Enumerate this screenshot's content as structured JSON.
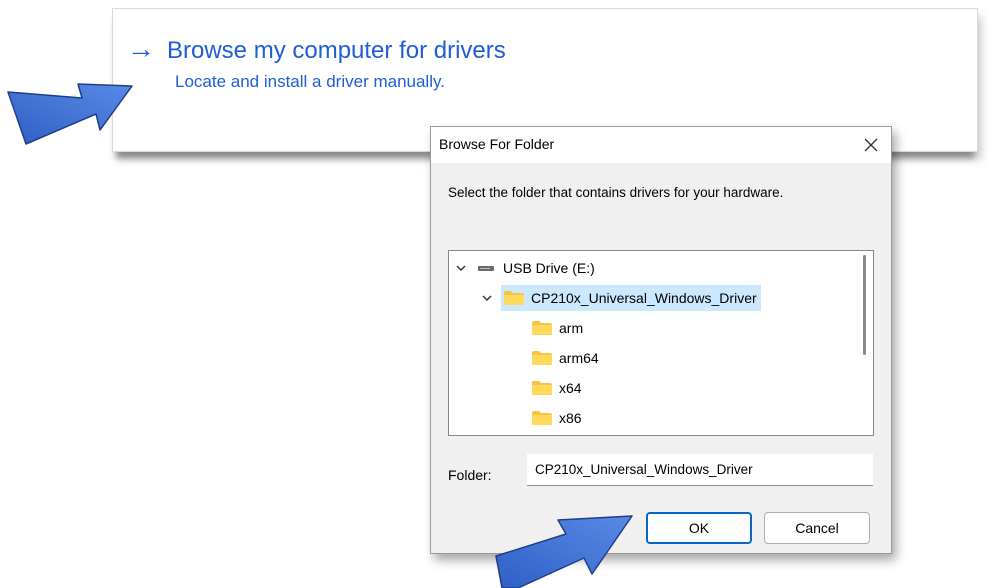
{
  "option": {
    "arrow": "→",
    "title": "Browse my computer for drivers",
    "subtitle": "Locate and install a driver manually."
  },
  "dialog": {
    "title": "Browse For Folder",
    "close_icon": "close-icon",
    "instruction": "Select the folder that contains drivers for your hardware.",
    "tree": [
      {
        "label": "USB Drive (E:)",
        "icon": "drive-icon",
        "expanded": true,
        "level": 0
      },
      {
        "label": "CP210x_Universal_Windows_Driver",
        "icon": "folder-icon",
        "expanded": true,
        "selected": true,
        "level": 1
      },
      {
        "label": "arm",
        "icon": "folder-icon",
        "level": 2
      },
      {
        "label": "arm64",
        "icon": "folder-icon",
        "level": 2
      },
      {
        "label": "x64",
        "icon": "folder-icon",
        "level": 2
      },
      {
        "label": "x86",
        "icon": "folder-icon",
        "level": 2
      }
    ],
    "folder_label": "Folder:",
    "folder_value": "CP210x_Universal_Windows_Driver",
    "ok_label": "OK",
    "cancel_label": "Cancel"
  },
  "colors": {
    "link_blue": "#1f5dd6",
    "selection": "#cce8ff",
    "callout_arrow": "#3a6fd8",
    "folder_yellow": "#f6c344"
  }
}
